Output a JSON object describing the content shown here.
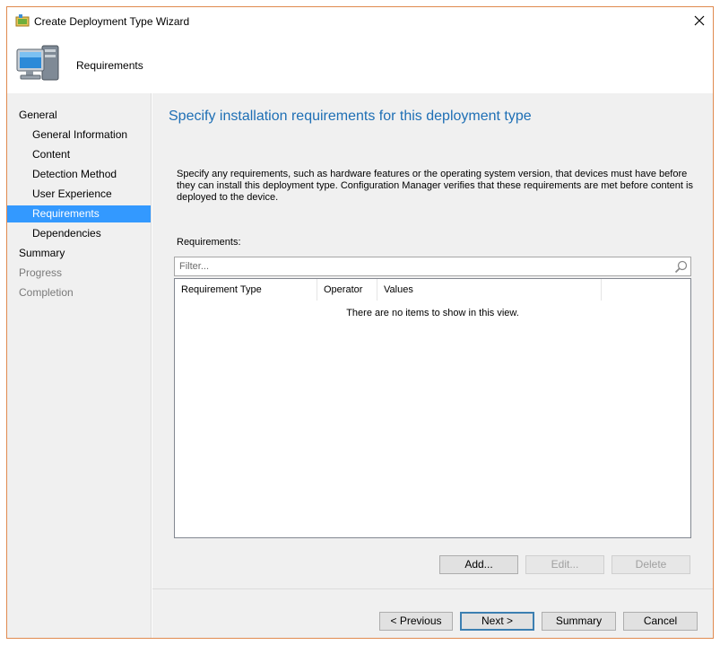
{
  "window": {
    "title": "Create Deployment Type Wizard",
    "close_label": "×"
  },
  "header": {
    "title": "Requirements"
  },
  "nav": {
    "items": [
      {
        "label": "General",
        "level": 1,
        "state": "normal"
      },
      {
        "label": "General Information",
        "level": 2,
        "state": "normal"
      },
      {
        "label": "Content",
        "level": 2,
        "state": "normal"
      },
      {
        "label": "Detection Method",
        "level": 2,
        "state": "normal"
      },
      {
        "label": "User Experience",
        "level": 2,
        "state": "normal"
      },
      {
        "label": "Requirements",
        "level": 2,
        "state": "selected"
      },
      {
        "label": "Dependencies",
        "level": 2,
        "state": "normal"
      },
      {
        "label": "Summary",
        "level": 1,
        "state": "normal"
      },
      {
        "label": "Progress",
        "level": 1,
        "state": "disabled"
      },
      {
        "label": "Completion",
        "level": 1,
        "state": "disabled"
      }
    ]
  },
  "main": {
    "heading": "Specify installation requirements for this deployment type",
    "description": "Specify any requirements, such as hardware features or the operating system version, that devices must have before they can install this deployment type. Configuration Manager verifies that these requirements are met before content is deployed to the device.",
    "requirements_label": "Requirements:",
    "filter_placeholder": "Filter...",
    "columns": [
      "Requirement Type",
      "Operator",
      "Values"
    ],
    "empty_message": "There are no items to show in this view.",
    "buttons": {
      "add": "Add...",
      "edit": "Edit...",
      "delete": "Delete"
    }
  },
  "footer": {
    "previous": "< Previous",
    "next": "Next >",
    "summary": "Summary",
    "cancel": "Cancel"
  },
  "colors": {
    "accent_heading": "#1e6fb5",
    "selection": "#3399ff",
    "window_border": "#e08a4f"
  }
}
